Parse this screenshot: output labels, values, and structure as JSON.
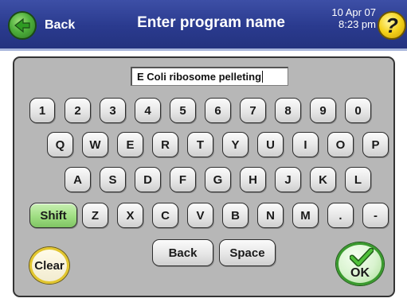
{
  "header": {
    "back_label": "Back",
    "title": "Enter program name",
    "date": "10 Apr 07",
    "time": "8:23 pm",
    "help_symbol": "?"
  },
  "input": {
    "value": "E Coli ribosome pelleting"
  },
  "keyboard": {
    "row1": [
      "1",
      "2",
      "3",
      "4",
      "5",
      "6",
      "7",
      "8",
      "9",
      "0"
    ],
    "row2": [
      "Q",
      "W",
      "E",
      "R",
      "T",
      "Y",
      "U",
      "I",
      "O",
      "P"
    ],
    "row3": [
      "A",
      "S",
      "D",
      "F",
      "G",
      "H",
      "J",
      "K",
      "L"
    ],
    "row4": [
      "Shift",
      "Z",
      "X",
      "C",
      "V",
      "B",
      "N",
      "M",
      ".",
      "-"
    ],
    "back_label": "Back",
    "space_label": "Space"
  },
  "actions": {
    "clear_label": "Clear",
    "ok_label": "OK"
  },
  "colors": {
    "header": "#2a3a8e",
    "panel": "#b7b7b7",
    "shift_key": "#9fde82",
    "clear_ring": "#e2c62f",
    "ok_ring": "#3a9a2e"
  }
}
